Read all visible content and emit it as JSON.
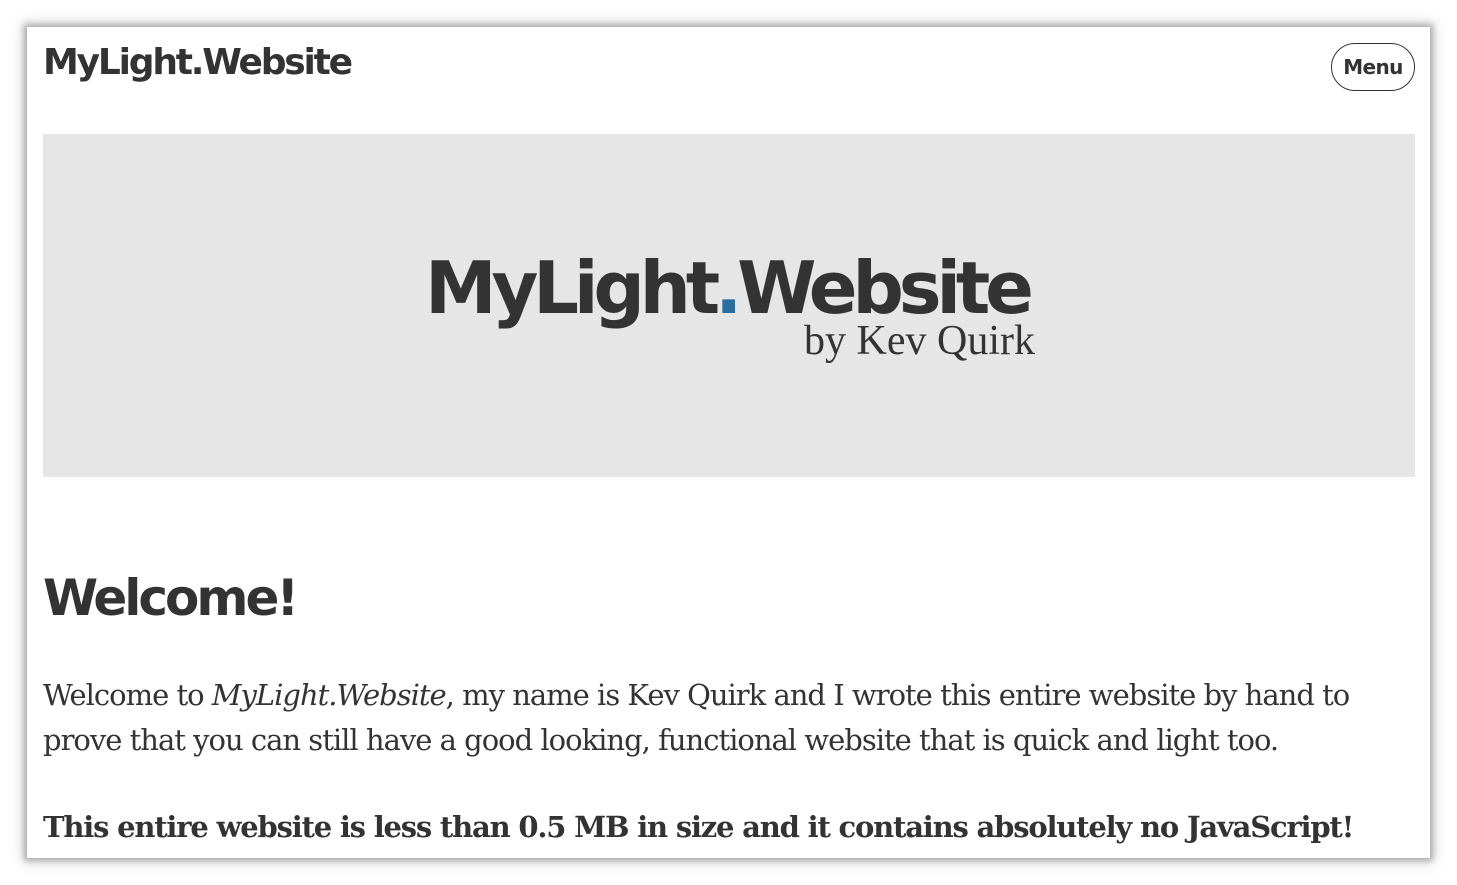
{
  "header": {
    "site_title": "MyLight.Website",
    "menu_label": "Menu"
  },
  "hero": {
    "logo_part1": "MyLight",
    "logo_dot": ".",
    "logo_part2": "Website",
    "logo_byline": "by Kev Quirk",
    "accent_color": "#2a6d9e",
    "background_color": "#e6e6e6"
  },
  "main": {
    "heading": "Welcome!",
    "intro_before": "Welcome to ",
    "intro_emphasis": "MyLight.Website",
    "intro_after": ", my name is Kev Quirk and I wrote this entire website by hand to prove that you can still have a good looking, functional website that is quick and light too.",
    "note": "This entire website is less than 0.5 MB in size and it contains absolutely no JavaScript!"
  }
}
